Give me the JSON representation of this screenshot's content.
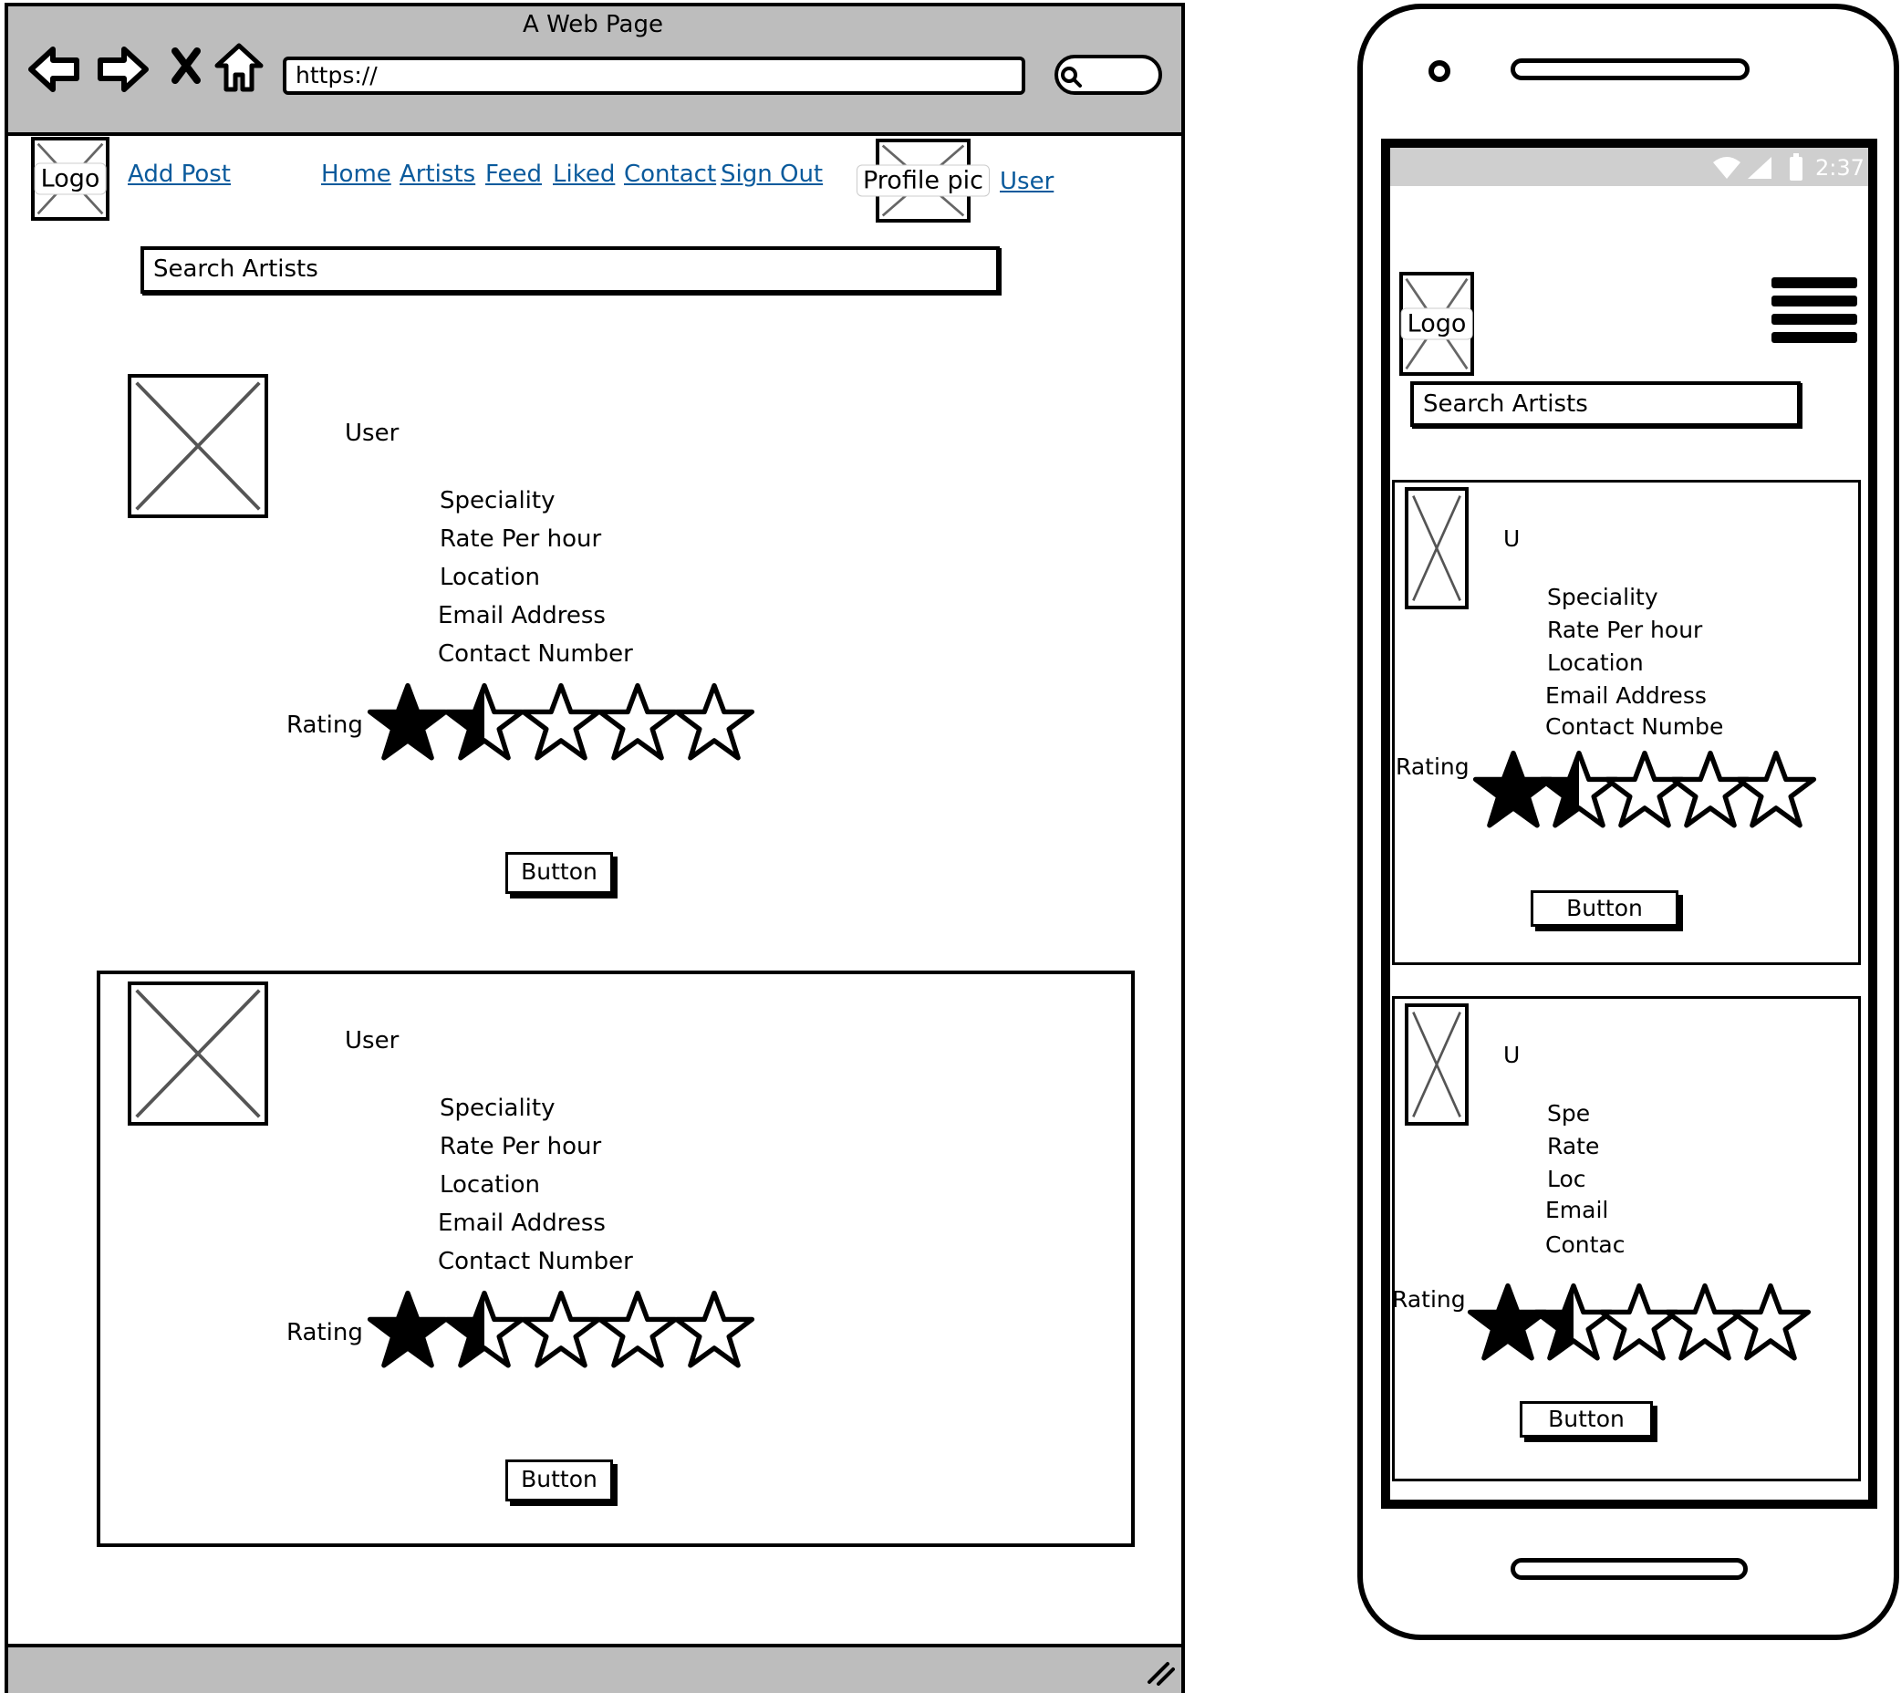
{
  "browser": {
    "title": "A Web Page",
    "url": "https://",
    "nav": {
      "logo": "Logo",
      "add_post": "Add Post",
      "links": [
        "Home",
        "Artists",
        "Feed",
        "Liked",
        "Contact",
        "Sign Out"
      ],
      "profile_pic": "Profile pic",
      "user": "User"
    },
    "search_placeholder": "Search Artists",
    "cards": [
      {
        "user": "User",
        "fields": [
          "Speciality",
          "Rate Per hour",
          "Location",
          "Email Address",
          "Contact Number"
        ],
        "rating_label": "Rating",
        "rating": 1.5,
        "rating_max": 5,
        "button": "Button"
      },
      {
        "user": "User",
        "fields": [
          "Speciality",
          "Rate Per hour",
          "Location",
          "Email Address",
          "Contact Number"
        ],
        "rating_label": "Rating",
        "rating": 1.5,
        "rating_max": 5,
        "button": "Button"
      }
    ]
  },
  "mobile": {
    "status_time": "2:37",
    "logo": "Logo",
    "search_placeholder": "Search Artists",
    "cards": [
      {
        "user": "U",
        "fields": [
          "Speciality",
          "Rate Per hour",
          "Location",
          "Email Address",
          "Contact Numbe"
        ],
        "rating_label": "Rating",
        "rating": 1.5,
        "rating_max": 5,
        "button": "Button"
      },
      {
        "user": "U",
        "fields": [
          "Spe",
          "Rate",
          "Loc",
          "Email",
          "Contac"
        ],
        "rating_label": "Rating",
        "rating": 1.5,
        "rating_max": 5,
        "button": "Button"
      }
    ]
  },
  "icons": [
    "back-arrow-icon",
    "forward-arrow-icon",
    "close-icon",
    "home-icon",
    "search-icon",
    "wifi-icon",
    "signal-icon",
    "battery-icon",
    "hamburger-menu-icon",
    "star-icon",
    "resize-grip-icon"
  ]
}
